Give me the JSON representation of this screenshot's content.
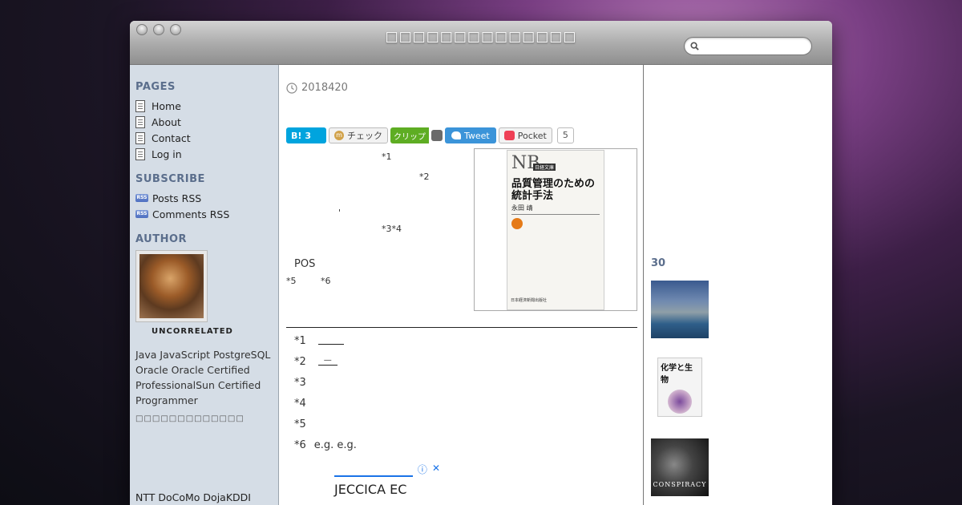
{
  "window": {
    "title": "□□□□□□□□□□□□□□",
    "search_placeholder": ""
  },
  "sidebar": {
    "pages_heading": "PAGES",
    "pages": [
      "Home",
      "About",
      "Contact",
      "Log in"
    ],
    "subscribe_heading": "SUBSCRIBE",
    "feeds": [
      "Posts RSS",
      "Comments RSS"
    ],
    "rss_badge": "RSS",
    "author_heading": "AUTHOR",
    "author_name": "UNCORRELATED",
    "bio": "Java JavaScript PostgreSQL Oracle Oracle Certified ProfessionalSun Certified Programmer",
    "bio_boxes": "□□□□□□□□□□□□□",
    "carrier": "NTT DoCoMo DojaKDDI"
  },
  "post": {
    "date": "2018420",
    "share": {
      "hatena_label": "B!",
      "hatena_count": "3",
      "mixi_label": "チェック",
      "mixi_icon": "m",
      "clip_label": "クリップ",
      "tweet_label": "Tweet",
      "pocket_label": "Pocket",
      "pocket_count": "5"
    },
    "refs": {
      "r1": "*1",
      "r2": "*2",
      "comma": "'",
      "r34": "*3*4",
      "pos": "POS",
      "r5": "*5",
      "r6": "*6"
    },
    "book": {
      "nb": "NB",
      "series": "日経文庫",
      "title": "品質管理のための統計手法",
      "author": "永田 靖",
      "publisher": "日本経済新聞出版社"
    },
    "footnotes": [
      {
        "mark": "*1",
        "text": ""
      },
      {
        "mark": "*2",
        "text": "—"
      },
      {
        "mark": "*3",
        "text": ""
      },
      {
        "mark": "*4",
        "text": ""
      },
      {
        "mark": "*5",
        "text": ""
      },
      {
        "mark": "*6",
        "text": "e.g. e.g."
      }
    ],
    "ad": {
      "text": "JECCICA EC",
      "info_icon": "ⓘ",
      "close_icon": "✕"
    }
  },
  "right": {
    "heading": "30",
    "thumb2_title": "化学と生物",
    "thumb3_caption": "CONSPIRACY"
  }
}
